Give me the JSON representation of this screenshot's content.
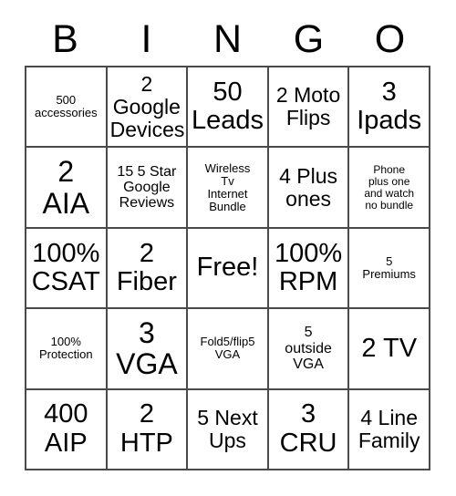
{
  "header": {
    "letters": [
      "B",
      "I",
      "N",
      "G",
      "O"
    ]
  },
  "grid": {
    "columns": 5,
    "rows": 5,
    "border_color": "#4a4a4a",
    "background_color": "#ffffff",
    "text_color": "#000000",
    "cells": [
      {
        "text": "500\naccessories",
        "size": "xs"
      },
      {
        "text": "2\nGoogle\nDevices",
        "size": "md"
      },
      {
        "text": "50\nLeads",
        "size": "lg"
      },
      {
        "text": "2 Moto\nFlips",
        "size": "md"
      },
      {
        "text": "3\nIpads",
        "size": "lg"
      },
      {
        "text": "2\nAIA",
        "size": "xl"
      },
      {
        "text": "15 5 Star\nGoogle\nReviews",
        "size": "sm"
      },
      {
        "text": "Wireless\nTv\nInternet\nBundle",
        "size": "xs"
      },
      {
        "text": "4 Plus\nones",
        "size": "md"
      },
      {
        "text": "Phone\nplus one\nand watch\nno bundle",
        "size": "xxs"
      },
      {
        "text": "100%\nCSAT",
        "size": "lg"
      },
      {
        "text": "2\nFiber",
        "size": "lg"
      },
      {
        "text": "Free!",
        "size": "lg"
      },
      {
        "text": "100%\nRPM",
        "size": "lg"
      },
      {
        "text": "5\nPremiums",
        "size": "xs"
      },
      {
        "text": "100%\nProtection",
        "size": "xs"
      },
      {
        "text": "3\nVGA",
        "size": "xl"
      },
      {
        "text": "Fold5/flip5\nVGA",
        "size": "xs"
      },
      {
        "text": "5\noutside\nVGA",
        "size": "sm"
      },
      {
        "text": "2 TV",
        "size": "lg"
      },
      {
        "text": "400\nAIP",
        "size": "lg"
      },
      {
        "text": "2\nHTP",
        "size": "lg"
      },
      {
        "text": "5 Next\nUps",
        "size": "md"
      },
      {
        "text": "3\nCRU",
        "size": "lg"
      },
      {
        "text": "4 Line\nFamily",
        "size": "md"
      }
    ]
  }
}
